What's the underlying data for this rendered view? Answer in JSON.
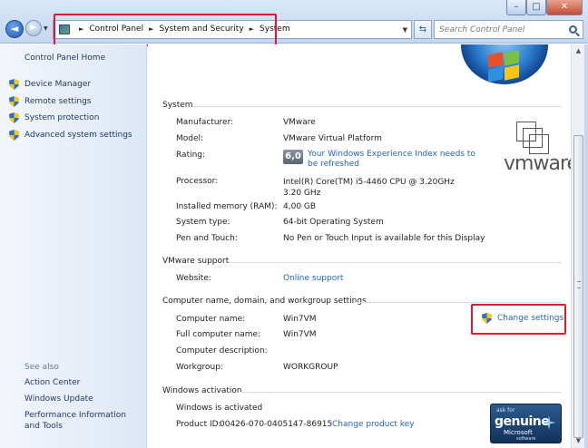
{
  "address": {
    "crumbs": [
      "Control Panel",
      "System and Security",
      "System"
    ],
    "search_placeholder": "Search Control Panel"
  },
  "window_buttons": {
    "minimize": "–",
    "maximize": "□",
    "close": "✕"
  },
  "left_pane": {
    "home": "Control Panel Home",
    "tasks": [
      "Device Manager",
      "Remote settings",
      "System protection",
      "Advanced system settings"
    ],
    "see_also_title": "See also",
    "see_also": [
      "Action Center",
      "Windows Update",
      "Performance Information and Tools"
    ]
  },
  "system": {
    "title": "System",
    "manufacturer_label": "Manufacturer:",
    "manufacturer": "VMware",
    "model_label": "Model:",
    "model": "VMware Virtual Platform",
    "rating_label": "Rating:",
    "rating_score": "6,0",
    "rating_link": "Your Windows Experience Index needs to be refreshed",
    "processor_label": "Processor:",
    "processor": "Intel(R) Core(TM) i5-4460  CPU @ 3.20GHz   3.20 GHz",
    "memory_label": "Installed memory (RAM):",
    "memory": "4,00 GB",
    "type_label": "System type:",
    "type": "64-bit Operating System",
    "pen_label": "Pen and Touch:",
    "pen": "No Pen or Touch Input is available for this Display"
  },
  "oem_logo_text": "vmware",
  "vmware_support": {
    "title": "VMware support",
    "website_label": "Website:",
    "website": "Online support"
  },
  "computer_name": {
    "title": "Computer name, domain, and workgroup settings",
    "name_label": "Computer name:",
    "name": "Win7VM",
    "full_label": "Full computer name:",
    "full": "Win7VM",
    "desc_label": "Computer description:",
    "desc": "",
    "workgroup_label": "Workgroup:",
    "workgroup": "WORKGROUP",
    "change_settings": "Change settings"
  },
  "activation": {
    "title": "Windows activation",
    "status": "Windows is activated",
    "product_id_label": "Product ID:",
    "product_id": "00426-070-0405147-86915",
    "change_key": "Change product key"
  },
  "genuine_badge": {
    "ask_for": "ask for",
    "genuine": "genuine",
    "microsoft": "Microsoft",
    "software": "software"
  },
  "colors": {
    "link": "#2364c5",
    "highlight_box": "#e3162b",
    "nav_text": "#1d3a6a"
  }
}
